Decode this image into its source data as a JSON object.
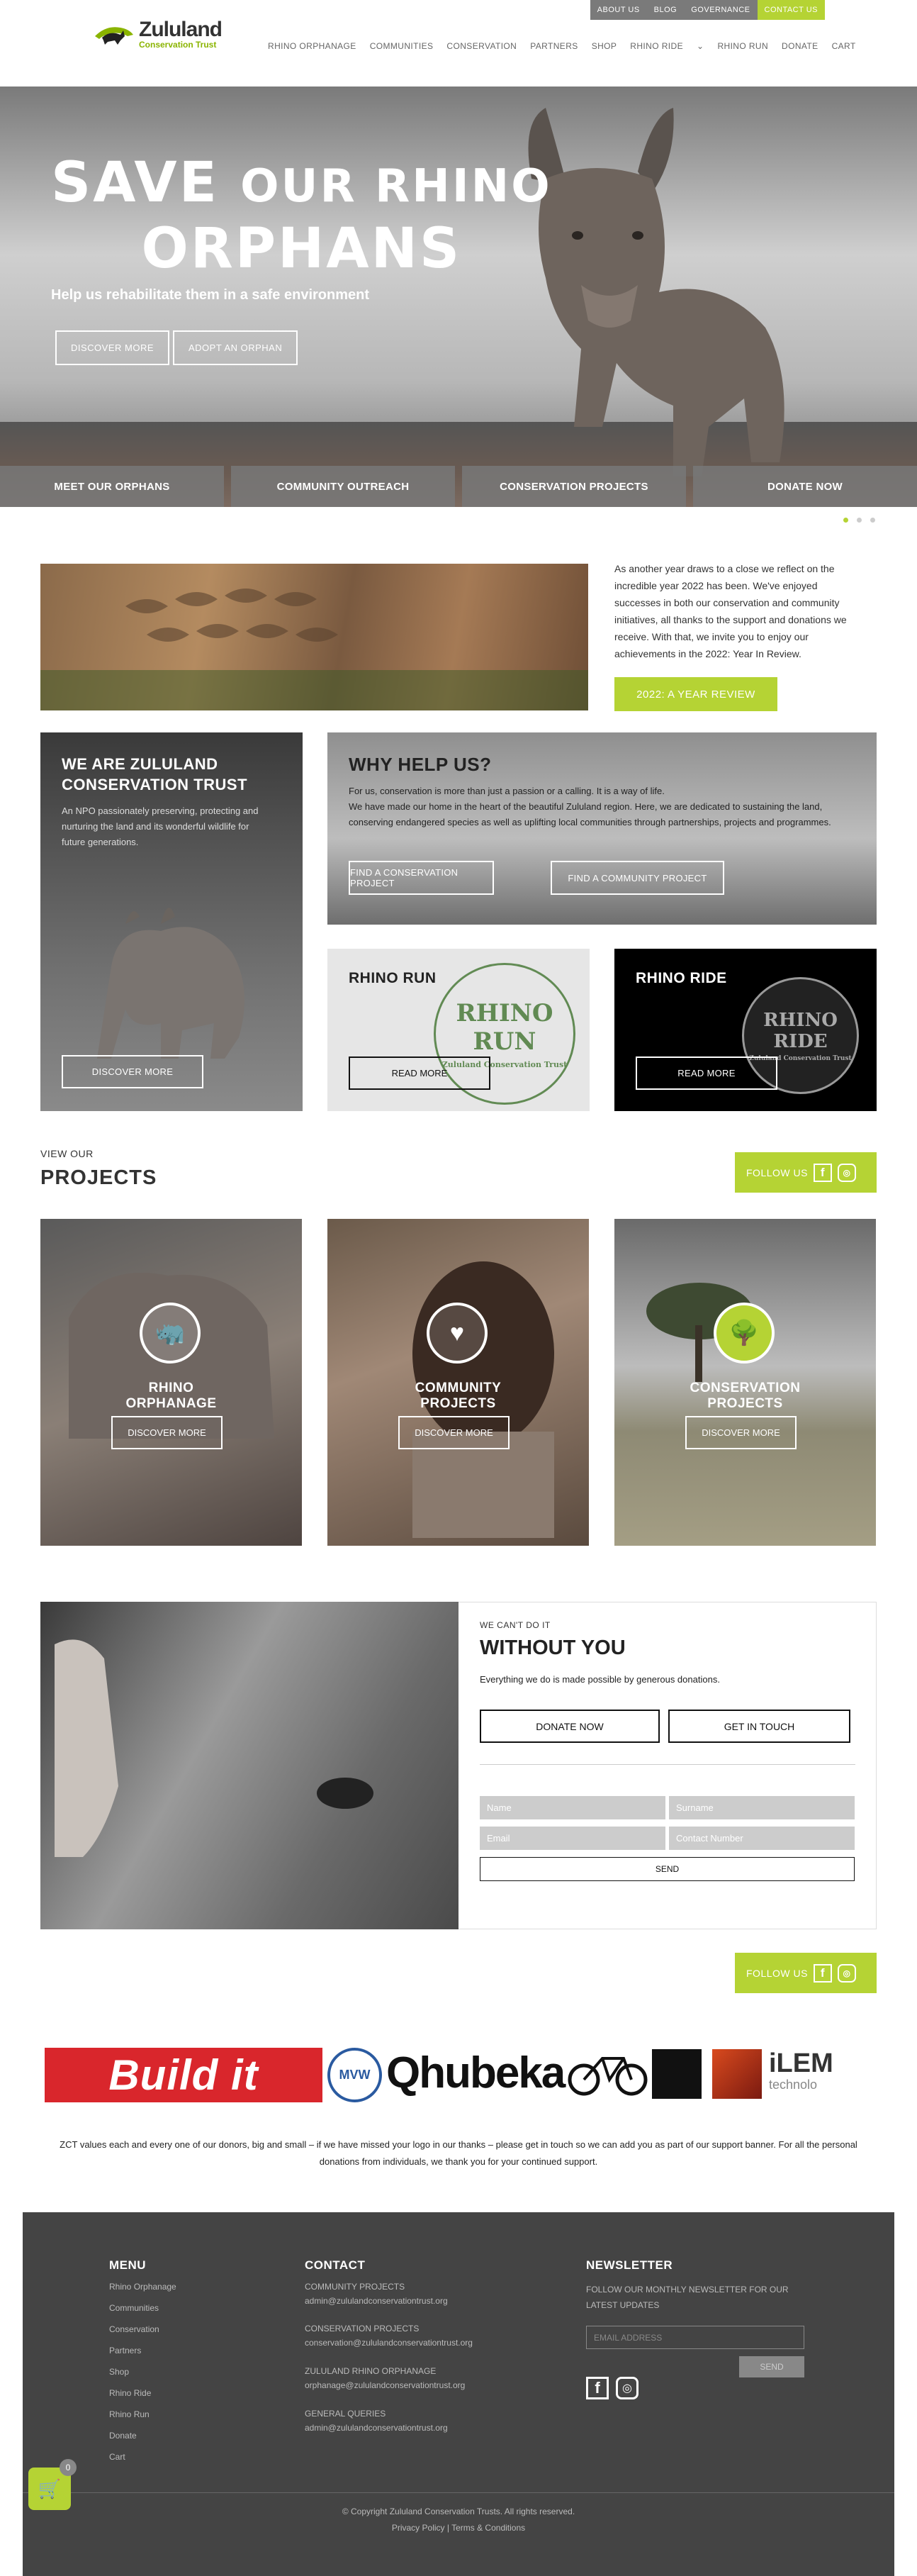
{
  "colors": {
    "accent": "#b5d334",
    "dark": "#444444"
  },
  "topbar": {
    "items": [
      "ABOUT US",
      "BLOG",
      "GOVERNANCE",
      "CONTACT US"
    ]
  },
  "logo": {
    "name": "Zululand",
    "sub": "Conservation Trust"
  },
  "nav": {
    "items": [
      "RHINO ORPHANAGE",
      "COMMUNITIES",
      "CONSERVATION",
      "PARTNERS",
      "SHOP",
      "RHINO RIDE",
      "RHINO RUN",
      "DONATE",
      "CART"
    ],
    "dropdown_icon": "chevron-down-icon"
  },
  "hero": {
    "line1a": "SAVE",
    "line1b": "OUR RHINO",
    "line2": "ORPHANS",
    "subtitle": "Help us rehabilitate them in a safe environment",
    "btn_discover": "DISCOVER MORE",
    "btn_adopt": "ADOPT AN ORPHAN",
    "tabs": [
      "MEET OUR ORPHANS",
      "COMMUNITY OUTREACH",
      "CONSERVATION PROJECTS",
      "DONATE NOW"
    ]
  },
  "review": {
    "text": "As another year draws to a close we reflect on the incredible year 2022 has been. We've enjoyed successes in both our conservation and community initiatives, all thanks to the support and donations we receive. With that, we invite you to enjoy our achievements in the 2022: Year In Review.",
    "button": "2022: A YEAR REVIEW"
  },
  "about": {
    "title1": "WE ARE ZULULAND",
    "title2": "CONSERVATION TRUST",
    "text": "An NPO passionately preserving, protecting and nurturing the land and its wonderful wildlife for future generations.",
    "button": "DISCOVER MORE"
  },
  "why": {
    "title": "WHY HELP US?",
    "p1": "For us, conservation is more than just a passion or a calling. It is a way of life.",
    "p2": "We have made our home in the heart of the beautiful Zululand region. Here, we are dedicated to sustaining the land, conserving endangered species as well as uplifting local communities through partnerships, projects and programmes.",
    "btn1": "FIND A CONSERVATION PROJECT",
    "btn2": "FIND A COMMUNITY PROJECT"
  },
  "rhino_run": {
    "title": "RHINO RUN",
    "button": "READ MORE",
    "badge_top": "RHINO",
    "badge_mid": "RUN",
    "badge_ring": "Zululand Conservation Trust"
  },
  "rhino_ride": {
    "title": "RHINO RIDE",
    "button": "READ MORE",
    "badge_top": "RHINO",
    "badge_mid": "RIDE",
    "badge_ring": "Zululand Conservation Trust"
  },
  "projects": {
    "label": "VIEW OUR",
    "title": "PROJECTS",
    "follow": "FOLLOW US",
    "items": [
      {
        "l1": "RHINO",
        "l2": "ORPHANAGE",
        "btn": "DISCOVER MORE",
        "icon": "rhino-icon"
      },
      {
        "l1": "COMMUNITY",
        "l2": "PROJECTS",
        "btn": "DISCOVER MORE",
        "icon": "heart-hand-icon"
      },
      {
        "l1": "CONSERVATION",
        "l2": "PROJECTS",
        "btn": "DISCOVER MORE",
        "icon": "tree-icon"
      }
    ]
  },
  "without": {
    "label": "WE CAN'T DO IT",
    "title": "WITHOUT YOU",
    "text": "Everything we do is made possible by generous donations.",
    "donate": "DONATE NOW",
    "touch": "GET IN TOUCH",
    "name": "Name",
    "surname": "Surname",
    "email": "Email",
    "contact": "Contact Number",
    "send": "SEND",
    "follow": "FOLLOW US"
  },
  "sponsors": {
    "buildit": "Build it",
    "mvw": "MVW",
    "qhubeka": "Qhubeka",
    "ilem": "iLEM",
    "ilem2": "technolo",
    "note": "ZCT values each and every one of our donors, big and small – if we have missed your logo in our thanks – please get in touch so we can add you as part of our support banner. For all the personal donations from individuals, we thank you for your continued support."
  },
  "footer": {
    "menu_title": "MENU",
    "menu": [
      "Rhino Orphanage",
      "Communities",
      "Conservation",
      "Partners",
      "Shop",
      "Rhino Ride",
      "Rhino Run",
      "Donate",
      "Cart"
    ],
    "contact_title": "CONTACT",
    "contacts": [
      {
        "h": "COMMUNITY PROJECTS",
        "e": "admin@zululandconservationtrust.org"
      },
      {
        "h": "CONSERVATION PROJECTS",
        "e": "conservation@zululandconservationtrust.org"
      },
      {
        "h": "ZULULAND RHINO ORPHANAGE",
        "e": "orphanage@zululandconservationtrust.org"
      },
      {
        "h": "GENERAL QUERIES",
        "e": "admin@zululandconservationtrust.org"
      }
    ],
    "news_title": "NEWSLETTER",
    "news_text": "FOLLOW OUR MONTHLY NEWSLETTER FOR OUR LATEST UPDATES",
    "email_ph": "EMAIL ADDRESS",
    "send": "SEND",
    "copyright": "© Copyright Zululand Conservation Trusts. All rights reserved.",
    "links": "Privacy Policy | Terms & Conditions"
  },
  "cart": {
    "count": "0"
  }
}
